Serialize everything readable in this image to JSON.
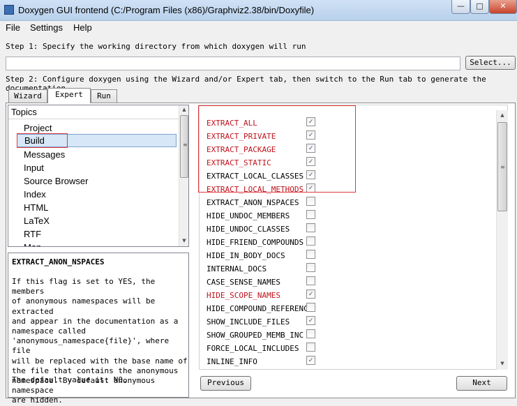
{
  "window": {
    "title": "Doxygen GUI frontend (C:/Program Files (x86)/Graphviz2.38/bin/Doxyfile)",
    "min_glyph": "—",
    "max_glyph": "□",
    "close_glyph": "✕"
  },
  "menu": [
    "File",
    "Settings",
    "Help"
  ],
  "step1": {
    "label": "Step 1: Specify the working directory from which doxygen will run",
    "value": "",
    "select_button": "Select..."
  },
  "step2": {
    "label": "Step 2: Configure doxygen using the Wizard and/or Expert tab, then switch to the Run tab to generate the documentation"
  },
  "tabs": [
    {
      "label": "Wizard",
      "active": false
    },
    {
      "label": "Expert",
      "active": true
    },
    {
      "label": "Run",
      "active": false
    }
  ],
  "topics": {
    "header": "Topics",
    "items": [
      "Project",
      "Build",
      "Messages",
      "Input",
      "Source Browser",
      "Index",
      "HTML",
      "LaTeX",
      "RTF",
      "Man"
    ],
    "selected": "Build"
  },
  "description": {
    "name": "EXTRACT_ANON_NSPACES",
    "body": "If this flag is set to YES, the members\nof anonymous namespaces will be extracted\nand appear in the documentation as a\nnamespace called\n'anonymous_namespace{file}', where file\nwill be replaced with the base name of\nthe file that contains the anonymous\nnamespace. By default anonymous namespace\nare hidden.",
    "default": "The default value is: NO."
  },
  "options": [
    {
      "name": "EXTRACT_ALL",
      "checked": true,
      "changed": true
    },
    {
      "name": "EXTRACT_PRIVATE",
      "checked": true,
      "changed": true
    },
    {
      "name": "EXTRACT_PACKAGE",
      "checked": true,
      "changed": true
    },
    {
      "name": "EXTRACT_STATIC",
      "checked": true,
      "changed": true
    },
    {
      "name": "EXTRACT_LOCAL_CLASSES",
      "checked": true,
      "changed": false
    },
    {
      "name": "EXTRACT_LOCAL_METHODS",
      "checked": true,
      "changed": true
    },
    {
      "name": "EXTRACT_ANON_NSPACES",
      "checked": false,
      "changed": false
    },
    {
      "name": "HIDE_UNDOC_MEMBERS",
      "checked": false,
      "changed": false
    },
    {
      "name": "HIDE_UNDOC_CLASSES",
      "checked": false,
      "changed": false
    },
    {
      "name": "HIDE_FRIEND_COMPOUNDS",
      "checked": false,
      "changed": false
    },
    {
      "name": "HIDE_IN_BODY_DOCS",
      "checked": false,
      "changed": false
    },
    {
      "name": "INTERNAL_DOCS",
      "checked": false,
      "changed": false
    },
    {
      "name": "CASE_SENSE_NAMES",
      "checked": false,
      "changed": false
    },
    {
      "name": "HIDE_SCOPE_NAMES",
      "checked": true,
      "changed": true
    },
    {
      "name": "HIDE_COMPOUND_REFERENCE",
      "checked": false,
      "changed": false
    },
    {
      "name": "SHOW_INCLUDE_FILES",
      "checked": true,
      "changed": false
    },
    {
      "name": "SHOW_GROUPED_MEMB_INC",
      "checked": false,
      "changed": false
    },
    {
      "name": "FORCE_LOCAL_INCLUDES",
      "checked": false,
      "changed": false
    },
    {
      "name": "INLINE_INFO",
      "checked": true,
      "changed": false
    }
  ],
  "nav": {
    "previous": "Previous",
    "next": "Next"
  },
  "colors": {
    "changed_option": "#c0121b",
    "highlight_box": "#e0383c",
    "selection": "#d7e7f7"
  }
}
